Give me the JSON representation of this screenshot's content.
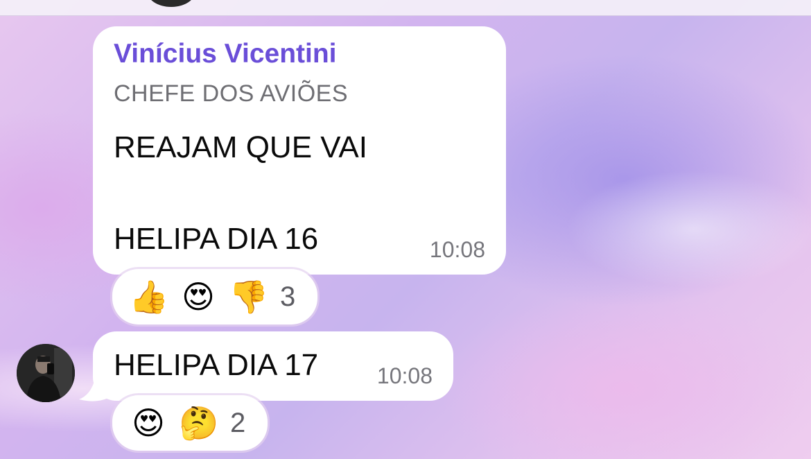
{
  "messages": [
    {
      "sender": "Vinícius Vicentini",
      "sender_title": "CHEFE DOS AVIÕES",
      "lines": [
        "REAJAM QUE VAI",
        "HELIPA DIA 16"
      ],
      "time": "10:08",
      "reactions": {
        "emojis": [
          {
            "glyph": "👍",
            "name": "thumbs-up-icon"
          },
          {
            "glyph": "😍",
            "name": "heart-eyes-icon"
          },
          {
            "glyph": "👎",
            "name": "thumbs-down-icon"
          }
        ],
        "count": "3"
      }
    },
    {
      "text": "HELIPA DIA 17",
      "time": "10:08",
      "reactions": {
        "emojis": [
          {
            "glyph": "😍",
            "name": "heart-eyes-icon"
          },
          {
            "glyph": "🤔",
            "name": "thinking-face-icon"
          }
        ],
        "count": "2"
      }
    }
  ],
  "colors": {
    "sender_name": "#6a4ed8",
    "bubble": "#ffffff",
    "timestamp": "#76767c"
  }
}
